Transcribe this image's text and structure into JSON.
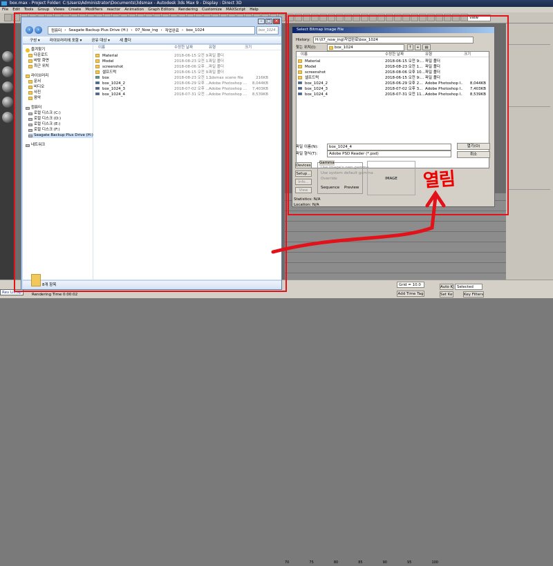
{
  "max": {
    "title": "box.max   -  Project Folder: C:\\Users\\Administrator\\Documents\\3dsmax   -  Autodesk 3ds Max 9   -  Display : Direct 3D",
    "menu": [
      "File",
      "Edit",
      "Tools",
      "Group",
      "Views",
      "Create",
      "Modifiers",
      "reactor",
      "Animation",
      "Graph Editors",
      "Rendering",
      "Customize",
      "MAXScript",
      "Help"
    ],
    "toolbar_view": "View",
    "viewport_tag": "Rev  Listap",
    "rendering_time": "Rendering Time  0:00:02",
    "grid": "Grid = 10.0",
    "add_time_tag": "Add Time Tag",
    "auto_key": "Auto Key",
    "selected": "Selected",
    "set_key": "Set Key",
    "key_filters": "Key Filters...",
    "slider_ticks": [
      "70",
      "75",
      "80",
      "85",
      "90",
      "95",
      "100"
    ]
  },
  "explorer": {
    "address": [
      "컴퓨터",
      "Seagate Backup Plus Drive (H:)",
      "07_Now_ing",
      "작업완료",
      "box_1024"
    ],
    "search_placeholder": "box_1024 ...",
    "toolbar": [
      "구성 ▾",
      "라이브러리에 포함 ▾",
      "공유 대상 ▾",
      "새 폴더"
    ],
    "columns": {
      "name": "이름",
      "date": "수정한 날짜",
      "type": "유형",
      "size": "크기"
    },
    "favorites": {
      "header": "즐겨찾기",
      "items": [
        "다운로드",
        "바탕 화면",
        "최근 위치"
      ]
    },
    "libraries": {
      "header": "라이브러리",
      "items": [
        "문서",
        "비디오",
        "사진",
        "음악"
      ]
    },
    "computer": {
      "header": "컴퓨터",
      "items": [
        "로컬 디스크 (C:)",
        "로컬 디스크 (D:)",
        "로컬 디스크 (E:)",
        "로컬 디스크 (F:)",
        "Seagate Backup Plus Drive (H:)"
      ]
    },
    "network": "네트워크",
    "files": [
      {
        "name": "Material",
        "date": "2018-06-15 오전 9...",
        "type": "파일 폴더",
        "size": "",
        "kind": "folder"
      },
      {
        "name": "Model",
        "date": "2018-08-23 오전 1...",
        "type": "파일 폴더",
        "size": "",
        "kind": "folder"
      },
      {
        "name": "screenshot",
        "date": "2018-08-06 오후 ...",
        "type": "파일 폴더",
        "size": "",
        "kind": "folder"
      },
      {
        "name": "셀프드럭",
        "date": "2018-06-15 오전 9...",
        "type": "파일 폴더",
        "size": "",
        "kind": "folder"
      },
      {
        "name": "box",
        "date": "2018-08-23 오전 1...",
        "type": "3dsmax scene file",
        "size": "216KB",
        "kind": "max"
      },
      {
        "name": "box_1024_2",
        "date": "2018-06-29 오후 ...",
        "type": "Adobe Photoshop ...",
        "size": "8,044KB",
        "kind": "psd"
      },
      {
        "name": "box_1024_3",
        "date": "2018-07-02 오후 ...",
        "type": "Adobe Photoshop ...",
        "size": "7,403KB",
        "kind": "psd"
      },
      {
        "name": "box_1024_4",
        "date": "2018-07-31 오전 ...",
        "type": "Adobe Photoshop ...",
        "size": "8,539KB",
        "kind": "psd"
      }
    ],
    "status": "8개 항목"
  },
  "dialog": {
    "title": "Select Bitmap Image File",
    "history_label": "History:",
    "history_value": "H:\\07_now_ing\\작업완료\\box_1024",
    "lookin_label": "찾는 위치(I):",
    "lookin_value": "box_1024",
    "columns": {
      "name": "이름",
      "date": "수정한 날짜",
      "type": "유형",
      "size": "크기"
    },
    "files": [
      {
        "name": "Material",
        "date": "2018-06-15 오전 9:...",
        "type": "파일 폴더",
        "size": "",
        "kind": "folder"
      },
      {
        "name": "Model",
        "date": "2018-08-23 오전 1...",
        "type": "파일 폴더",
        "size": "",
        "kind": "folder"
      },
      {
        "name": "screenshot",
        "date": "2018-08-06 오후 10...",
        "type": "파일 폴더",
        "size": "",
        "kind": "folder"
      },
      {
        "name": "셀프드럭",
        "date": "2018-06-15 오전 9:...",
        "type": "파일 폴더",
        "size": "",
        "kind": "folder"
      },
      {
        "name": "box_1024_2",
        "date": "2018-06-29 오후 2...",
        "type": "Adobe Photoshop I...",
        "size": "8,044KB",
        "kind": "psd"
      },
      {
        "name": "box_1024_3",
        "date": "2018-07-02 오후 3...",
        "type": "Adobe Photoshop I...",
        "size": "7,403KB",
        "kind": "psd"
      },
      {
        "name": "box_1024_4",
        "date": "2018-07-31 오전 11...",
        "type": "Adobe Photoshop I...",
        "size": "8,539KB",
        "kind": "psd"
      }
    ],
    "filename_label": "파일 이름(N):",
    "filename_value": "box_1024_4",
    "filetype_label": "파일 형식(T):",
    "filetype_value": "Adobe PSD Reader (*.psd)",
    "open": "열기(O)",
    "cancel": "취소",
    "devices": "Devices...",
    "setup": "Setup...",
    "info": "Info...",
    "view": "View",
    "gamma": "Gamma",
    "gamma_opts": [
      "Use image's own gamma",
      "Use system default gamma",
      "Override"
    ],
    "sequence": "Sequence",
    "preview": "Preview",
    "image": "IMAGE",
    "statistics": "Statistics:  N/A",
    "location": "Location:  N/A"
  },
  "annotation": "열림",
  "colors": {
    "highlight": "#e2121a"
  }
}
